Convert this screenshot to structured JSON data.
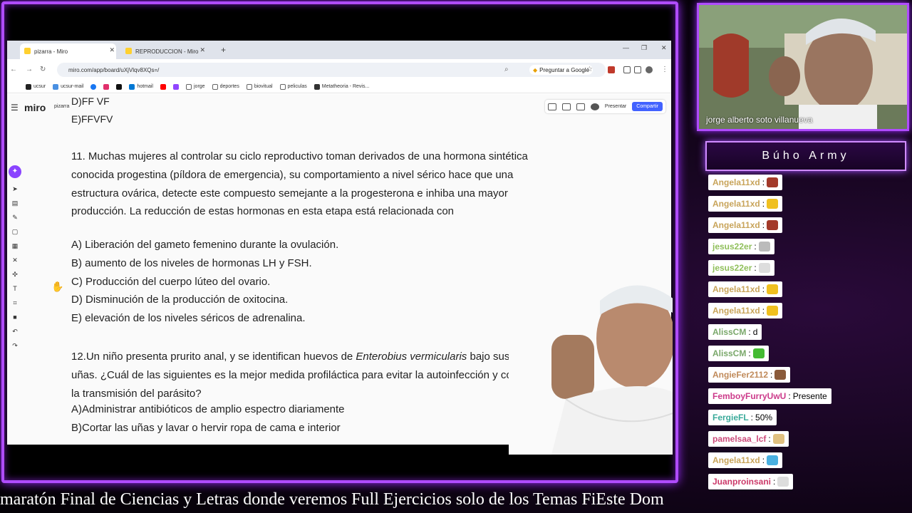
{
  "browser": {
    "tabs": [
      {
        "label": "pizarra - Miro",
        "active": true
      },
      {
        "label": "REPRODUCCION - Miro",
        "active": false
      }
    ],
    "url": "miro.com/app/board/uXjVlqv8XQs=/",
    "ask_google": "Preguntar a Google",
    "bookmarks": [
      "ucsur",
      "ucsur-mail",
      "hotmail",
      "jorge",
      "deportes",
      "biovitual",
      "peliculas",
      "Metatheoria - Revis..."
    ]
  },
  "miro": {
    "logo": "miro",
    "board_name": "pizarra",
    "present": "Presentar",
    "share": "Compartir"
  },
  "document": {
    "prev_d": "D)FF VF",
    "prev_e": "E)FFVFV",
    "q11": "11.    Muchas mujeres al controlar su ciclo reproductivo toman derivados de una hormona sintética conocida progestina (píldora de emergencia), su comportamiento a nivel sérico hace que una estructura ovárica, detecte este compuesto semejante a la progesterona e inhiba una mayor producción. La reducción de estas hormonas en esta etapa está relacionada con",
    "q11_options": [
      "A)   Liberación del gameto femenino durante la ovulación.",
      "B)   aumento de los niveles de hormonas LH y FSH.",
      "C)   Producción del cuerpo lúteo del ovario.",
      "D)   Disminución de la producción de oxitocina.",
      "E)   elevación de los niveles séricos de adrenalina."
    ],
    "q12_lead": " 12.Un niño presenta prurito anal, y se identifican huevos de ",
    "q12_italic": "Enterobius vermicularis",
    "q12_tail": " bajo sus uñas. ¿Cuál de las siguientes es la mejor medida profiláctica para evitar la autoinfección y cortar la transmisión del parásito?",
    "q12_options": [
      "A)Administrar antibióticos de amplio espectro diariamente",
      "B)Cortar las uñas y lavar o hervir ropa de cama e interior"
    ]
  },
  "camera": {
    "name": "jorge  alberto soto villanueva"
  },
  "panel_title": "Búho Army",
  "chat": [
    {
      "user": "Angela11xd",
      "text": "",
      "color": "#c8a45a",
      "emote": "#a33a2a"
    },
    {
      "user": "Angela11xd",
      "text": "",
      "color": "#c8a45a",
      "emote": "#f0c020"
    },
    {
      "user": "Angela11xd",
      "text": "",
      "color": "#c8a45a",
      "emote": "#a33a2a"
    },
    {
      "user": "jesus22er",
      "text": "",
      "color": "#8fbf5a",
      "emote": "#bbbbbb"
    },
    {
      "user": "jesus22er",
      "text": "",
      "color": "#8fbf5a",
      "emote": "#dddddd"
    },
    {
      "user": "Angela11xd",
      "text": "",
      "color": "#c8a45a",
      "emote": "#f0c020"
    },
    {
      "user": "Angela11xd",
      "text": "",
      "color": "#c8a45a",
      "emote": "#f0c020"
    },
    {
      "user": "AlissCM",
      "text": "d",
      "color": "#7aa86a",
      "emote": ""
    },
    {
      "user": "AlissCM",
      "text": "",
      "color": "#7aa86a",
      "emote": "#44bb33"
    },
    {
      "user": "AngieFer2112",
      "text": "",
      "color": "#c08a5a",
      "emote": "#8a5a3a"
    },
    {
      "user": "FemboyFurryUwU",
      "text": "Presente",
      "color": "#cc3a8a",
      "emote": ""
    },
    {
      "user": "FergieFL",
      "text": "50%",
      "color": "#3aaa9a",
      "emote": ""
    },
    {
      "user": "pamelsaa_lcf",
      "text": "",
      "color": "#cc4a7a",
      "emote": "#e0c080"
    },
    {
      "user": "Angela11xd",
      "text": "",
      "color": "#c8a45a",
      "emote": "#4ab0e0"
    },
    {
      "user": "Juanproinsani",
      "text": "",
      "color": "#cc3a6a",
      "emote": "#dddddd"
    }
  ],
  "ticker": "maratón Final de Ciencias y Letras donde veremos Full Ejercicios solo de los Temas FiEste Dom",
  "colors": {
    "frame": "#b04cff",
    "miro_share": "#4262ff",
    "miro_ai": "#8a44ff"
  }
}
